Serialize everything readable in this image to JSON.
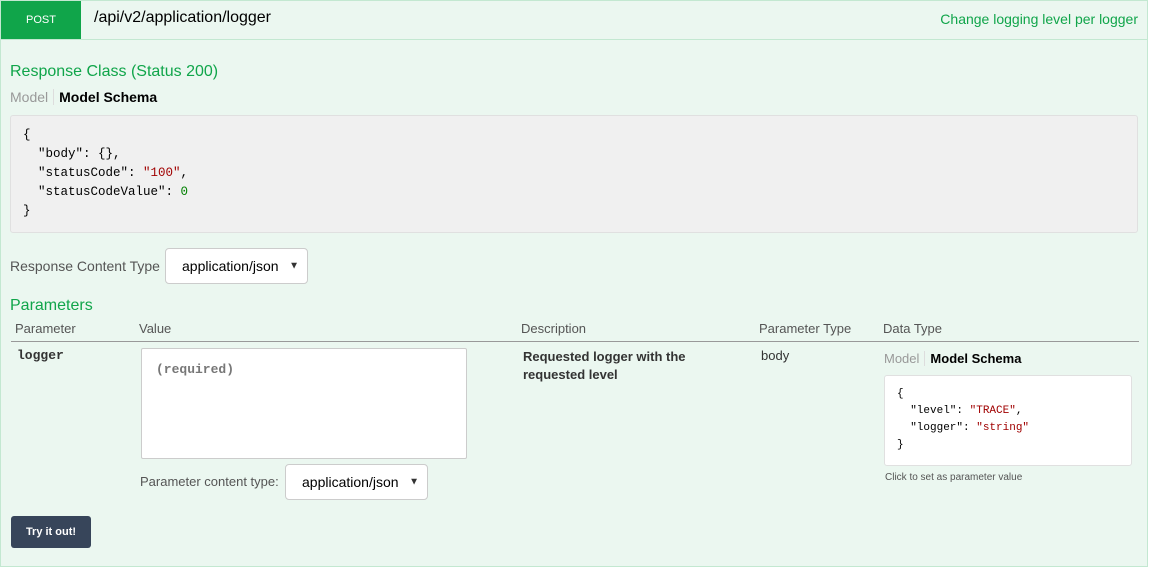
{
  "operation": {
    "method": "POST",
    "path": "/api/v2/application/logger",
    "summary": "Change logging level per logger"
  },
  "response_class": {
    "heading": "Response Class (Status 200)",
    "tab_model": "Model",
    "tab_schema": "Model Schema",
    "schema_lines": {
      "open": "{",
      "body_key": "  \"body\": {},",
      "status_code_key": "  \"statusCode\": ",
      "status_code_val": "\"100\"",
      "status_code_tail": ",",
      "status_code_value_key": "  \"statusCodeValue\": ",
      "status_code_value_val": "0",
      "close": "}"
    }
  },
  "response_content_type": {
    "label": "Response Content Type",
    "selected": "application/json"
  },
  "parameters": {
    "heading": "Parameters",
    "columns": [
      "Parameter",
      "Value",
      "Description",
      "Parameter Type",
      "Data Type"
    ],
    "rows": [
      {
        "name": "logger",
        "placeholder": "(required)",
        "description": "Requested logger with the requested level",
        "param_type": "body",
        "data_type": {
          "tab_model": "Model",
          "tab_schema": "Model Schema",
          "schema": {
            "open": "{",
            "level_key": "  \"level\": ",
            "level_val": "\"TRACE\"",
            "level_tail": ",",
            "logger_key": "  \"logger\": ",
            "logger_val": "\"string\"",
            "close": "}"
          },
          "hint": "Click to set as parameter value"
        },
        "content_type_label": "Parameter content type:",
        "content_type_selected": "application/json"
      }
    ]
  },
  "try_button": "Try it out!",
  "colors": {
    "method_bg": "#10a54a",
    "panel_bg": "#ebf7f0",
    "button_bg": "#37455a"
  }
}
